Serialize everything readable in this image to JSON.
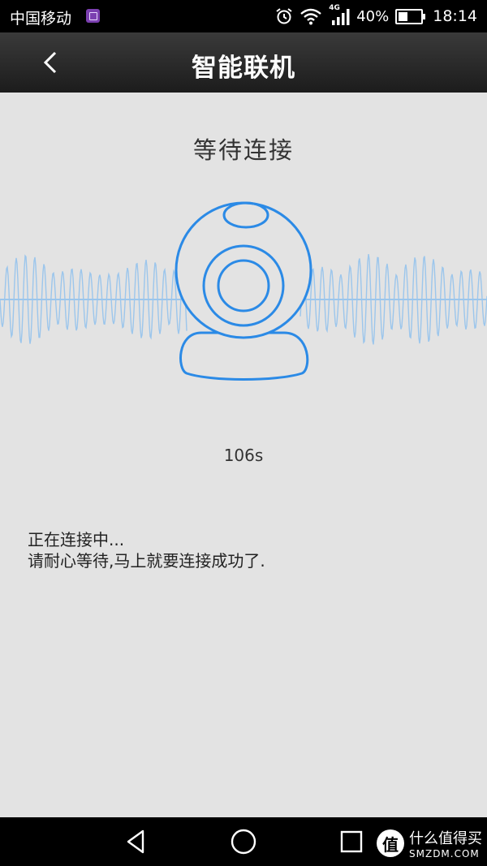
{
  "status_bar": {
    "carrier": "中国移动",
    "network": "4G",
    "battery": "40%",
    "time": "18:14"
  },
  "app_bar": {
    "title": "智能联机",
    "back_icon": "chevron-left-icon"
  },
  "main": {
    "heading": "等待连接",
    "countdown": "106s",
    "message_line1": "正在连接中...",
    "message_line2": "请耐心等待,马上就要连接成功了."
  },
  "colors": {
    "accent": "#2b8ae6",
    "wave": "#9cc6ec",
    "background": "#e3e3e3"
  },
  "nav_bar": {
    "back_icon": "triangle-back-icon",
    "home_icon": "circle-home-icon",
    "recent_icon": "square-recent-icon"
  },
  "watermark": {
    "logo": "值",
    "text": "什么值得买",
    "subtext": "SMZDM.COM"
  }
}
